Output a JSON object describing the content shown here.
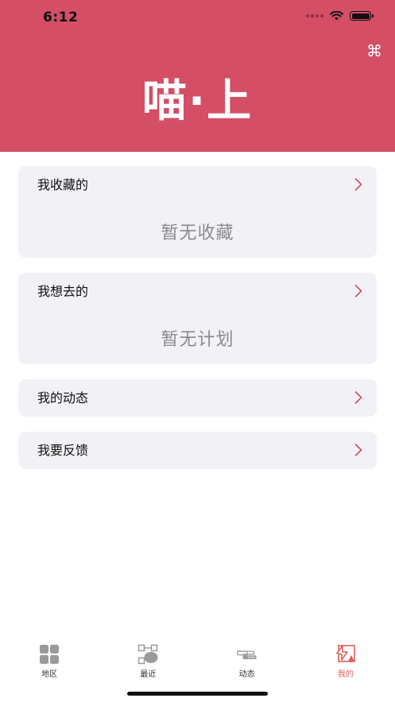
{
  "status_bar": {
    "time": "6:12"
  },
  "header": {
    "title": "喵·上",
    "action_icon": "command-icon",
    "background": "#d44e66"
  },
  "cards": [
    {
      "title": "我收藏的",
      "empty_text": "暂无收藏"
    },
    {
      "title": "我想去的",
      "empty_text": "暂无计划"
    },
    {
      "title": "我的动态"
    },
    {
      "title": "我要反馈"
    }
  ],
  "tabbar": {
    "items": [
      {
        "label": "地区",
        "icon": "grid-icon"
      },
      {
        "label": "最近",
        "icon": "recent-icon"
      },
      {
        "label": "动态",
        "icon": "dynamic-icon"
      },
      {
        "label": "我的",
        "icon": "profile-icon",
        "active": true
      }
    ],
    "active_color": "#e0605a"
  }
}
